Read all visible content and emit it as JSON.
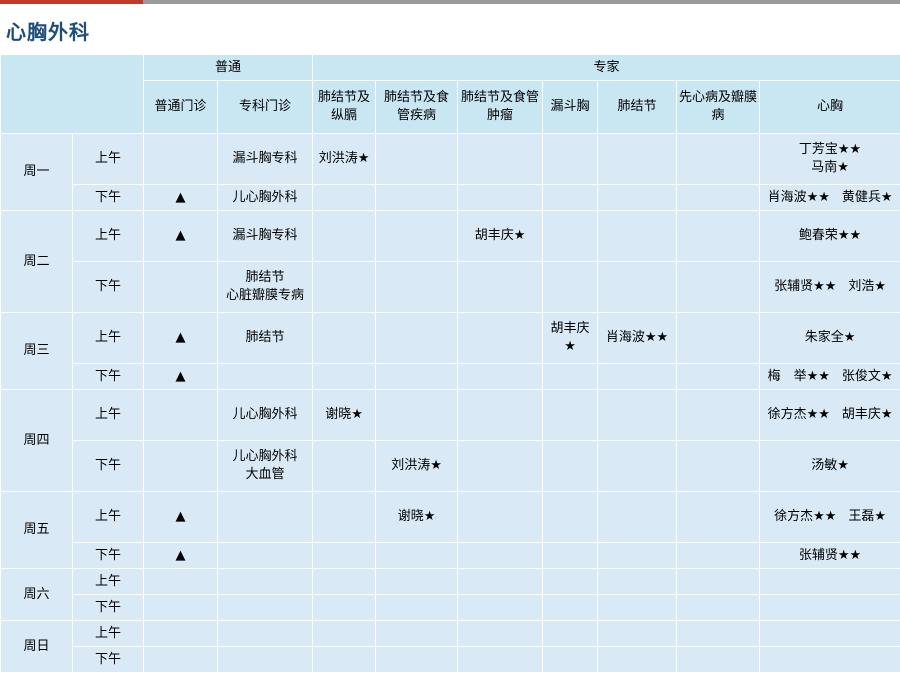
{
  "title": "心胸外科",
  "header": {
    "group_general": "普通",
    "group_expert": "专家",
    "columns": [
      "普通门诊",
      "专科门诊",
      "肺结节及纵膈",
      "肺结节及食管疾病",
      "肺结节及食管肿瘤",
      "漏斗胸",
      "肺结节",
      "先心病及瓣膜病",
      "心胸"
    ]
  },
  "days": [
    {
      "day": "周一",
      "sessions": [
        {
          "period": "上午",
          "general": "",
          "special": [
            "漏斗胸专科"
          ],
          "e_mediastinum": "刘洪涛★",
          "e_esoph_disease": "",
          "e_esoph_tumor": "",
          "e_funnel": [],
          "e_nodule": "",
          "e_valve": "",
          "e_heart": [
            "丁芳宝★★",
            "马南★"
          ]
        },
        {
          "period": "下午",
          "general": "▲",
          "special": [
            "儿心胸外科"
          ],
          "e_mediastinum": "",
          "e_esoph_disease": "",
          "e_esoph_tumor": "",
          "e_funnel": [],
          "e_nodule": "",
          "e_valve": "",
          "e_heart": [
            "肖海波★★",
            "黄健兵★"
          ]
        }
      ]
    },
    {
      "day": "周二",
      "sessions": [
        {
          "period": "上午",
          "general": "▲",
          "special": [
            "漏斗胸专科"
          ],
          "e_mediastinum": "",
          "e_esoph_disease": "",
          "e_esoph_tumor": "胡丰庆★",
          "e_funnel": [],
          "e_nodule": "",
          "e_valve": "",
          "e_heart": [
            "鲍春荣★★"
          ]
        },
        {
          "period": "下午",
          "general": "",
          "special": [
            "肺结节",
            "心脏瓣膜专病"
          ],
          "e_mediastinum": "",
          "e_esoph_disease": "",
          "e_esoph_tumor": "",
          "e_funnel": [],
          "e_nodule": "",
          "e_valve": "",
          "e_heart": [
            "张辅贤★★",
            "刘浩★"
          ]
        }
      ]
    },
    {
      "day": "周三",
      "sessions": [
        {
          "period": "上午",
          "general": "▲",
          "special": [
            "肺结节"
          ],
          "e_mediastinum": "",
          "e_esoph_disease": "",
          "e_esoph_tumor": "",
          "e_funnel": [
            "胡丰庆",
            "★"
          ],
          "e_nodule": "肖海波★★",
          "e_valve": "",
          "e_heart": [
            "朱家全★"
          ]
        },
        {
          "period": "下午",
          "general": "▲",
          "special": [],
          "e_mediastinum": "",
          "e_esoph_disease": "",
          "e_esoph_tumor": "",
          "e_funnel": [],
          "e_nodule": "",
          "e_valve": "",
          "e_heart": [
            "梅　举★★",
            "张俊文★"
          ]
        }
      ]
    },
    {
      "day": "周四",
      "sessions": [
        {
          "period": "上午",
          "general": "",
          "special": [
            "儿心胸外科"
          ],
          "e_mediastinum": "谢晓★",
          "e_esoph_disease": "",
          "e_esoph_tumor": "",
          "e_funnel": [],
          "e_nodule": "",
          "e_valve": "",
          "e_heart": [
            "徐方杰★★",
            "胡丰庆★"
          ]
        },
        {
          "period": "下午",
          "general": "",
          "special": [
            "儿心胸外科",
            "大血管"
          ],
          "e_mediastinum": "",
          "e_esoph_disease": "刘洪涛★",
          "e_esoph_tumor": "",
          "e_funnel": [],
          "e_nodule": "",
          "e_valve": "",
          "e_heart": [
            "汤敏★"
          ]
        }
      ]
    },
    {
      "day": "周五",
      "sessions": [
        {
          "period": "上午",
          "general": "▲",
          "special": [],
          "e_mediastinum": "",
          "e_esoph_disease": "谢晓★",
          "e_esoph_tumor": "",
          "e_funnel": [],
          "e_nodule": "",
          "e_valve": "",
          "e_heart": [
            "徐方杰★★",
            "王磊★"
          ]
        },
        {
          "period": "下午",
          "general": "▲",
          "special": [],
          "e_mediastinum": "",
          "e_esoph_disease": "",
          "e_esoph_tumor": "",
          "e_funnel": [],
          "e_nodule": "",
          "e_valve": "",
          "e_heart": [
            "张辅贤★★"
          ]
        }
      ]
    },
    {
      "day": "周六",
      "sessions": [
        {
          "period": "上午",
          "general": "",
          "special": [],
          "e_mediastinum": "",
          "e_esoph_disease": "",
          "e_esoph_tumor": "",
          "e_funnel": [],
          "e_nodule": "",
          "e_valve": "",
          "e_heart": []
        },
        {
          "period": "下午",
          "general": "",
          "special": [],
          "e_mediastinum": "",
          "e_esoph_disease": "",
          "e_esoph_tumor": "",
          "e_funnel": [],
          "e_nodule": "",
          "e_valve": "",
          "e_heart": []
        }
      ]
    },
    {
      "day": "周日",
      "sessions": [
        {
          "period": "上午",
          "general": "",
          "special": [],
          "e_mediastinum": "",
          "e_esoph_disease": "",
          "e_esoph_tumor": "",
          "e_funnel": [],
          "e_nodule": "",
          "e_valve": "",
          "e_heart": []
        },
        {
          "period": "下午",
          "general": "",
          "special": [],
          "e_mediastinum": "",
          "e_esoph_disease": "",
          "e_esoph_tumor": "",
          "e_funnel": [],
          "e_nodule": "",
          "e_valve": "",
          "e_heart": []
        }
      ]
    }
  ]
}
